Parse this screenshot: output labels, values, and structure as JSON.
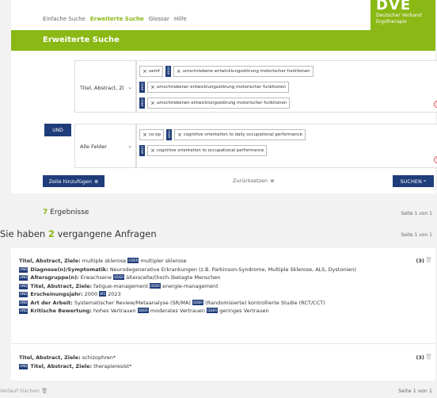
{
  "nav": {
    "items": [
      "Einfache Suche",
      "Erweiterte Suche",
      "Glossar",
      "Hilfe"
    ]
  },
  "logo": {
    "mark": "DVE",
    "line1": "Deutscher Verband",
    "line2": "Ergotherapie"
  },
  "header": {
    "title": "Erweiterte Suche"
  },
  "search": {
    "row1": {
      "field": "Titel, Abstract, Zi",
      "lines": [
        [
          {
            "type": "chip",
            "text": "uemf"
          },
          {
            "type": "oder"
          },
          {
            "type": "chip",
            "text": "umschriebene entwicklungsstörung motorischer funktionen"
          }
        ],
        [
          {
            "type": "oder"
          },
          {
            "type": "chip",
            "text": "umschriebener entwicklungsstörung motorischer funktionen"
          }
        ],
        [
          {
            "type": "oder"
          },
          {
            "type": "chip",
            "text": "umschriebenen entwicklungsstörung motorischer funktionen"
          }
        ]
      ]
    },
    "row2": {
      "operator": "UND",
      "field": "Alle Felder",
      "lines": [
        [
          {
            "type": "chip",
            "text": "co-op"
          },
          {
            "type": "oder"
          },
          {
            "type": "chip",
            "text": "cognitive orientation to daily occupational performance"
          }
        ],
        [
          {
            "type": "oder"
          },
          {
            "type": "chip",
            "text": "cognitive orientation to occupational performance"
          }
        ]
      ]
    },
    "oder_label": "ODER",
    "add_row_label": "Zeile hinzufügen",
    "reset_label": "Zurücksetzen",
    "search_label": "SUCHEN"
  },
  "results": {
    "count": "7",
    "label": "Ergebnisse",
    "page": "Seite 1 von 1"
  },
  "previous": {
    "prefix": "Sie haben",
    "count": "2",
    "suffix": "vergangene Anfragen",
    "page": "Seite 1 von 1"
  },
  "history": {
    "q1": {
      "count": "(3)",
      "first": {
        "label": "Titel, Abstract, Ziele:",
        "a": "multiple sklerose",
        "op": "ODER",
        "b": "multipler sklerose"
      },
      "lines": [
        {
          "label": "Diagnose(n)/Symptomatik:",
          "text": "Neurodegenerative Erkrankungen (z.B. Parkinson-Syndrome, Multiple Sklerose, ALS, Dystonien)"
        },
        {
          "label": "Altersgruppe(n):",
          "a": "Erwachsene",
          "op": "ODER",
          "b": "ältere/alte/(hoch-)betagte Menschen"
        },
        {
          "label": "Titel, Abstract, Ziele:",
          "a": "fatigue-management",
          "op": "ODER",
          "b": "energie-management"
        },
        {
          "label": "Erscheinungsjahr:",
          "a": "2000",
          "op": "BIS",
          "b": "2023"
        },
        {
          "label": "Art der Arbeit:",
          "a": "Systematischer Review/Metaanalyse (SR/MA)",
          "op": "ODER",
          "b": "(Randomisierte) kontrollierte Studie (RCT/CCT)"
        },
        {
          "label": "Kritische Bewertung:",
          "a": "hohes Vertrauen",
          "op": "ODER",
          "b": "moderates Vertrauen",
          "op2": "ODER",
          "c": "geringes Vertrauen"
        }
      ]
    },
    "q2": {
      "count": "(3)",
      "first": {
        "label": "Titel, Abstract, Ziele:",
        "a": "schizophren*"
      },
      "line": {
        "label": "Titel, Abstract, Ziele:",
        "a": "therapieresist*"
      }
    },
    "und": "UND"
  },
  "footer": {
    "clear_label": "Verlauf löschen",
    "page": "Seite 1 von 1"
  }
}
